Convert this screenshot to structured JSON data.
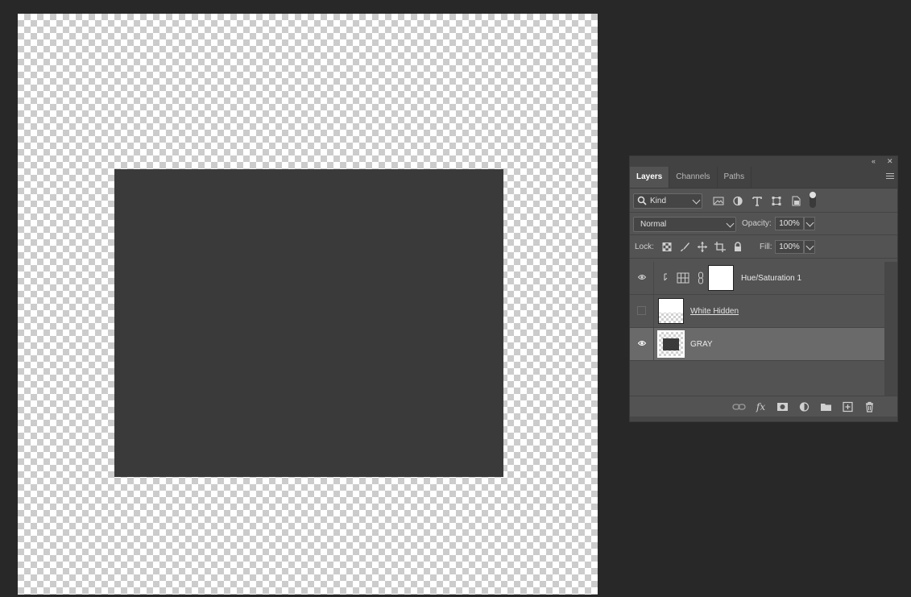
{
  "panel": {
    "collapse_icon": "double-chevron-left-icon",
    "close_icon": "close-icon",
    "tabs": [
      {
        "label": "Layers",
        "active": true
      },
      {
        "label": "Channels",
        "active": false
      },
      {
        "label": "Paths",
        "active": false
      }
    ],
    "filter": {
      "kind_label": "Kind",
      "icons": [
        "image-filter-icon",
        "adjustment-filter-icon",
        "type-filter-icon",
        "shape-filter-icon",
        "smart-object-filter-icon"
      ]
    },
    "blend_mode": "Normal",
    "opacity_label": "Opacity:",
    "opacity_value": "100%",
    "lock_label": "Lock:",
    "fill_label": "Fill:",
    "fill_value": "100%",
    "layers": [
      {
        "name": "Hue/Saturation 1",
        "visible": true,
        "type": "adjustment",
        "clipped": true
      },
      {
        "name": "White Hidden",
        "visible": false,
        "type": "pixel"
      },
      {
        "name": "GRAY",
        "visible": true,
        "type": "pixel",
        "selected": true
      }
    ],
    "bottom_icons": [
      "link-icon",
      "fx-icon",
      "mask-icon",
      "adjustment-layer-icon",
      "folder-icon",
      "new-layer-icon",
      "trash-icon"
    ]
  },
  "colors": {
    "app_bg": "#282828",
    "panel_bg": "#535353",
    "selected_layer": "#6a6a6a",
    "canvas_rect": "#3a3a3a"
  }
}
